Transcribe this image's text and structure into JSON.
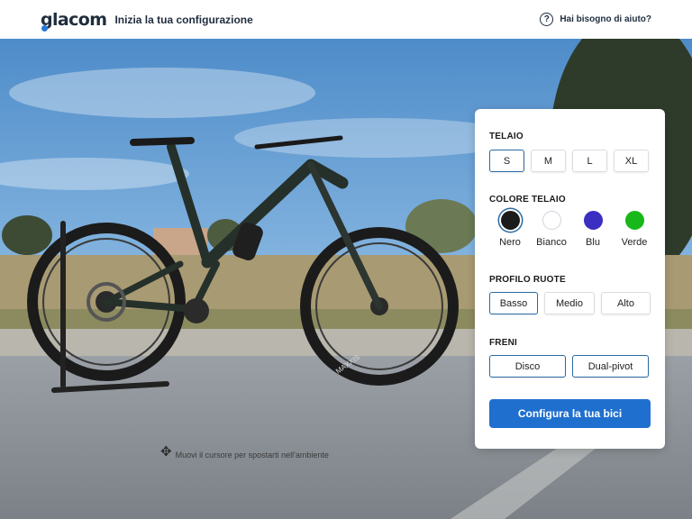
{
  "header": {
    "logo_text": "glacom",
    "title": "Inizia la tua configurazione",
    "help_label": "Hai bisogno di aiuto?",
    "help_icon": "question-circle-icon"
  },
  "scene": {
    "hint_icon": "move-arrows-icon",
    "hint_text": "Muovi il cursore per spostarti nell'ambiente",
    "tire_brand": "MAXXIS"
  },
  "panel": {
    "frame": {
      "title": "TELAIO",
      "options": [
        "S",
        "M",
        "L",
        "XL"
      ],
      "selected": "S"
    },
    "frame_color": {
      "title": "COLORE TELAIO",
      "options": [
        {
          "label": "Nero",
          "color": "#1b1b1b"
        },
        {
          "label": "Bianco",
          "color": "#ffffff"
        },
        {
          "label": "Blu",
          "color": "#3a2fc0"
        },
        {
          "label": "Verde",
          "color": "#18b81a"
        }
      ],
      "selected": "Nero"
    },
    "wheel_profile": {
      "title": "PROFILO RUOTE",
      "options": [
        "Basso",
        "Medio",
        "Alto"
      ],
      "selected": "Basso"
    },
    "brakes": {
      "title": "FRENI",
      "options": [
        "Disco",
        "Dual-pivot"
      ],
      "selected": "Disco"
    },
    "cta_label": "Configura la tua bici"
  },
  "colors": {
    "accent": "#1f6fcf",
    "selected_border": "#2b6aa3"
  }
}
